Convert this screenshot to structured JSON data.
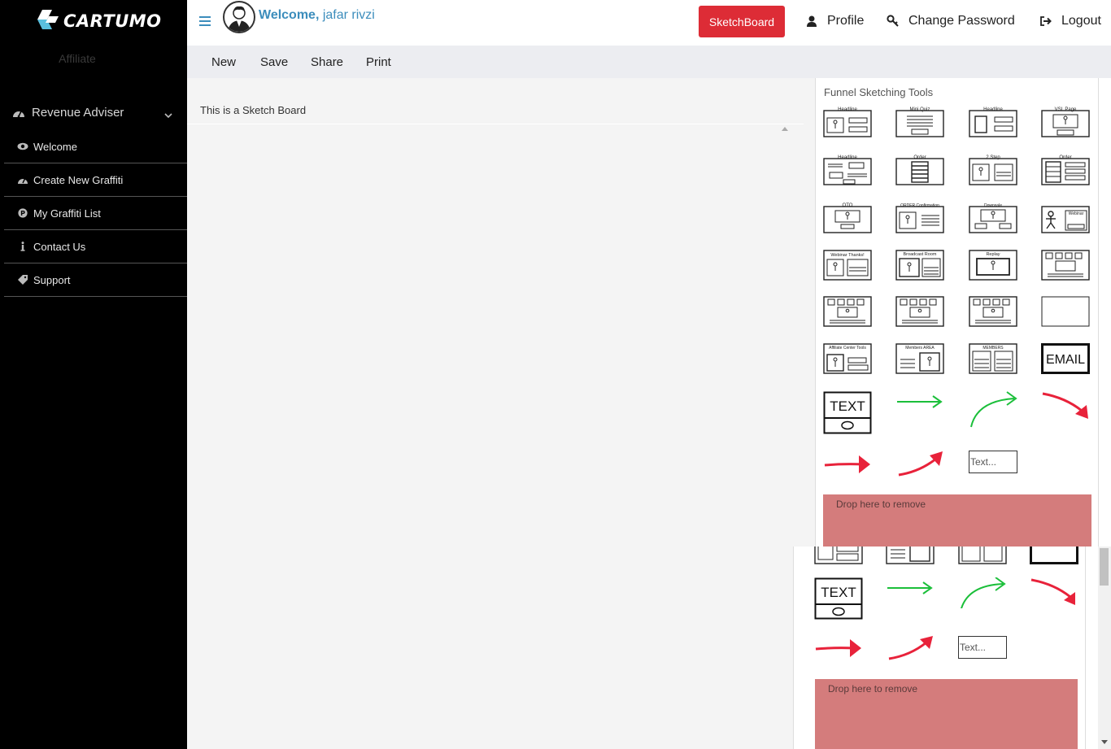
{
  "brand": {
    "name": "CARTUMO",
    "subtitle": "Affiliate"
  },
  "sidebar": {
    "group": {
      "label": "Revenue Adviser",
      "icon": "dashboard-icon"
    },
    "items": [
      {
        "label": "Welcome",
        "icon": "eye-icon"
      },
      {
        "label": "Create New Graffiti",
        "icon": "dashboard-icon"
      },
      {
        "label": "My Graffiti List",
        "icon": "p-circle-icon"
      },
      {
        "label": "Contact Us",
        "icon": "info-icon"
      },
      {
        "label": "Support",
        "icon": "tag-icon"
      }
    ]
  },
  "header": {
    "welcome_prefix": "Welcome,",
    "user_name": " jafar rivzi",
    "sketch_button": "SketchBoard",
    "profile": "Profile",
    "change_password": "Change Password",
    "logout": "Logout",
    "accent_color": "#3c8dbc",
    "button_color": "#dd2c36"
  },
  "toolbar": {
    "new": "New",
    "save": "Save",
    "share": "Share",
    "print": "Print"
  },
  "board": {
    "title": "This is a Sketch Board"
  },
  "tools_panel": {
    "title": "Funnel Sketching Tools",
    "tools": [
      "Headline",
      "Mini Quiz",
      "Headline",
      "VSL Page",
      "Headline",
      "Order",
      "2 Step",
      "Order",
      "OTO",
      "ORDER Confirmation",
      "Downsale",
      "Webinar",
      "Webinar Thanks!",
      "Broadcast Room",
      "Replay",
      "",
      "",
      "",
      "",
      "",
      "Affiliate Center Tools",
      "Members AREA",
      "MEMBERS",
      "EMAIL"
    ],
    "text_tool_label": "TEXT",
    "text_input_placeholder": "Text...",
    "drop_zone": "Drop here to remove"
  }
}
